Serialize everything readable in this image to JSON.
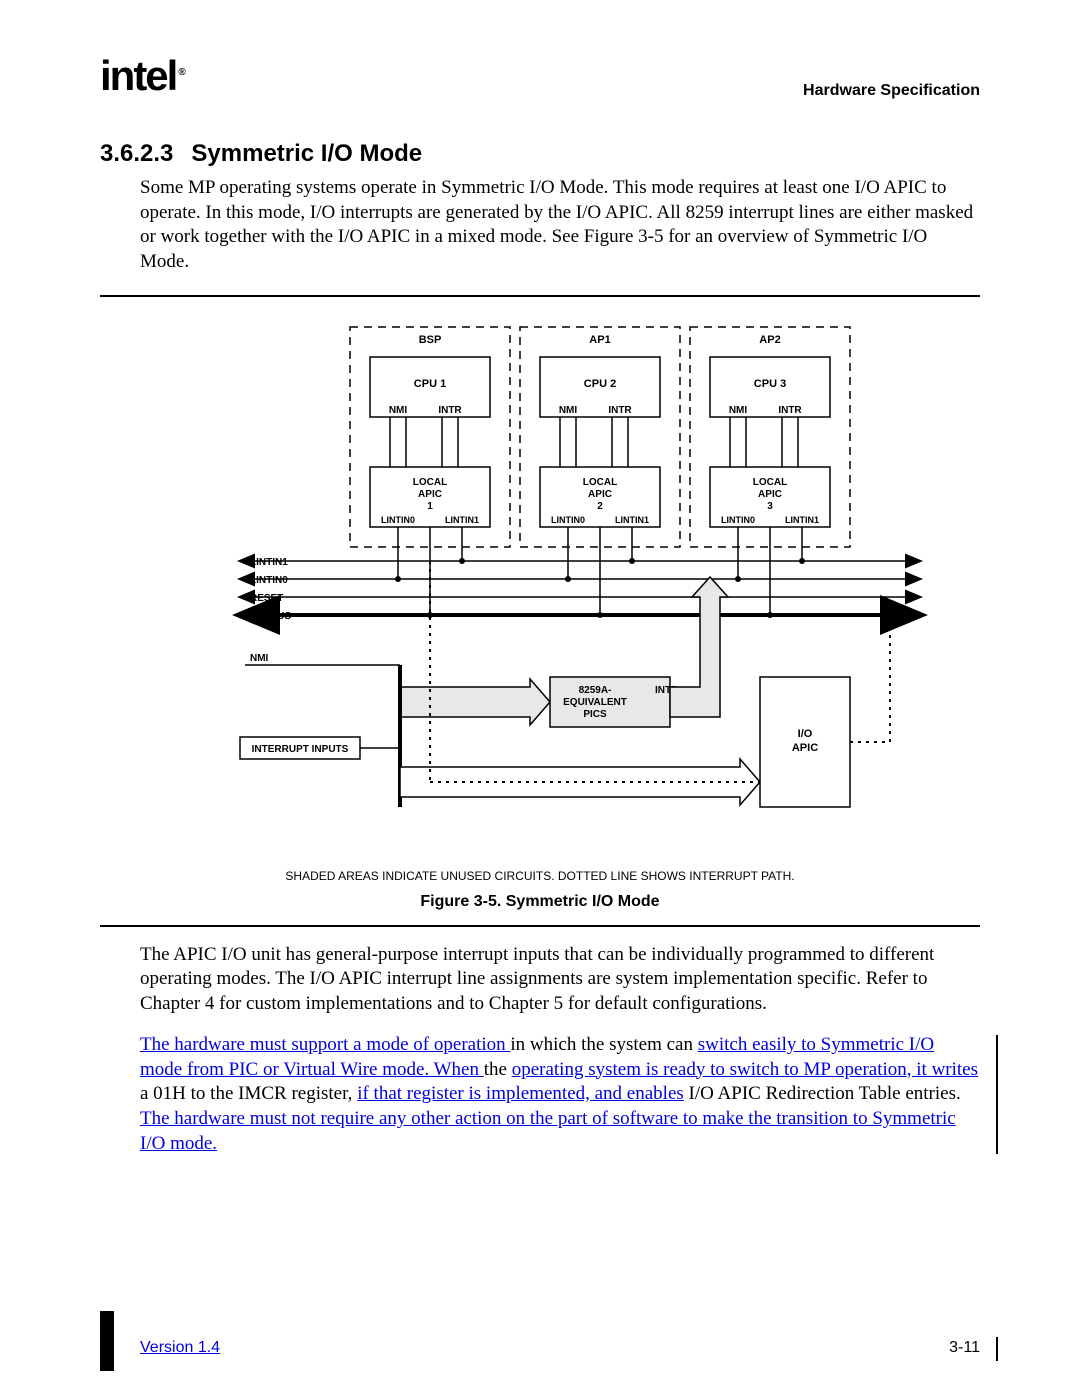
{
  "header": {
    "logo_text": "intel",
    "reg": "®",
    "doc_type": "Hardware Specification"
  },
  "section": {
    "number": "3.6.2.3",
    "title": "Symmetric I/O Mode"
  },
  "paragraph1": "Some MP operating systems operate in Symmetric I/O Mode.  This mode requires at least one I/O APIC to operate.  In this mode, I/O interrupts are generated by the I/O APIC.  All 8259 interrupt lines are either masked or work together with the I/O APIC in a mixed mode.  See Figure 3-5 for an overview of Symmetric I/O Mode.",
  "figure": {
    "caption": "Figure 3-5.  Symmetric I/O Mode",
    "note": "SHADED AREAS INDICATE UNUSED CIRCUITS.  DOTTED LINE SHOWS INTERRUPT PATH.",
    "labels": {
      "bsp": "BSP",
      "ap1": "AP1",
      "ap2": "AP2",
      "cpu1": "CPU 1",
      "cpu2": "CPU 2",
      "cpu3": "CPU 3",
      "nmi": "NMI",
      "intr": "INTR",
      "local_apic1_l1": "LOCAL",
      "local_apic1_l2": "APIC",
      "local_apic1_l3": "1",
      "local_apic2_l3": "2",
      "local_apic3_l3": "3",
      "lintin0": "LINTIN0",
      "lintin1": "LINTIN1",
      "bus_lintin1": "LINTIN1",
      "bus_lintin0": "LINTIN0",
      "bus_reset": "RESET",
      "bus_icc": "ICC BUS",
      "bus_nmi": "NMI",
      "interrupt_inputs": "INTERRUPT INPUTS",
      "pics_l1": "8259A-",
      "pics_l2": "EQUIVALENT",
      "pics_l3": "PICS",
      "pics_intr": "INTR",
      "io_apic_l1": "I/O",
      "io_apic_l2": "APIC"
    }
  },
  "paragraph2": "The APIC I/O unit has general-purpose interrupt inputs that can be individually programmed to different operating modes.  The I/O APIC interrupt line assignments are system implementation specific.  Refer to Chapter 4 for custom implementations and to Chapter 5 for default configurations.",
  "paragraph3": {
    "link1": "The hardware must support a mode of operation ",
    "plain1": "in which the system can ",
    "link2": "switch easily to Symmetric I/O mode from PIC or Virtual Wire mode. When ",
    "plain2": "the ",
    "link3": "operating system is ready to switch to MP operation, it writes",
    "plain3": " a 01H to the IMCR register, ",
    "link4": "if that register is implemented, and enables",
    "plain4": " I/O APIC Redirection Table entries. ",
    "link5": "The hardware must not require any other action on the part of software to make the transition to Symmetric I/O mode."
  },
  "footer": {
    "version": "Version 1.4",
    "page": "3-11"
  }
}
